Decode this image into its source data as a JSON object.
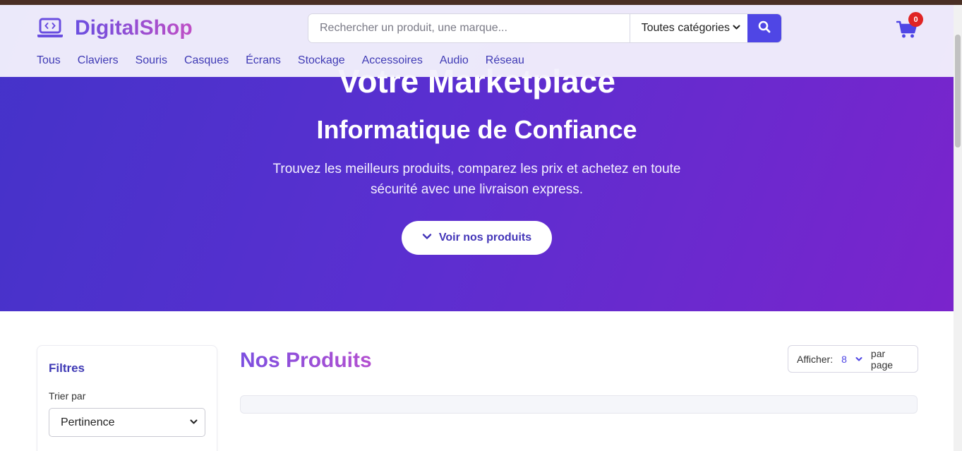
{
  "header": {
    "brand": "DigitalShop",
    "search_placeholder": "Rechercher un produit, une marque...",
    "category_selected": "Toutes catégories",
    "cart_count": "0",
    "nav": [
      "Tous",
      "Claviers",
      "Souris",
      "Casques",
      "Écrans",
      "Stockage",
      "Accessoires",
      "Audio",
      "Réseau"
    ]
  },
  "hero": {
    "title_line1": "Votre Marketplace",
    "title_line2": "Informatique de Confiance",
    "subtitle": "Trouvez les meilleurs produits, comparez les prix et achetez en toute sécurité avec une livraison express.",
    "cta_label": "Voir nos produits"
  },
  "filters": {
    "title": "Filtres",
    "sort_label": "Trier par",
    "sort_selected": "Pertinence"
  },
  "products": {
    "title": "Nos Produits",
    "per_page_label": "Afficher:",
    "per_page_value": "8",
    "per_page_suffix": "par page"
  },
  "colors": {
    "primary": "#4f46e5",
    "hero_start": "#4433c9",
    "hero_end": "#7a24cc",
    "badge": "#e02424"
  },
  "icons": {
    "logo": "laptop-code-icon",
    "search": "search-icon",
    "cart": "shopping-cart-icon",
    "cta": "chevron-down-icon"
  }
}
